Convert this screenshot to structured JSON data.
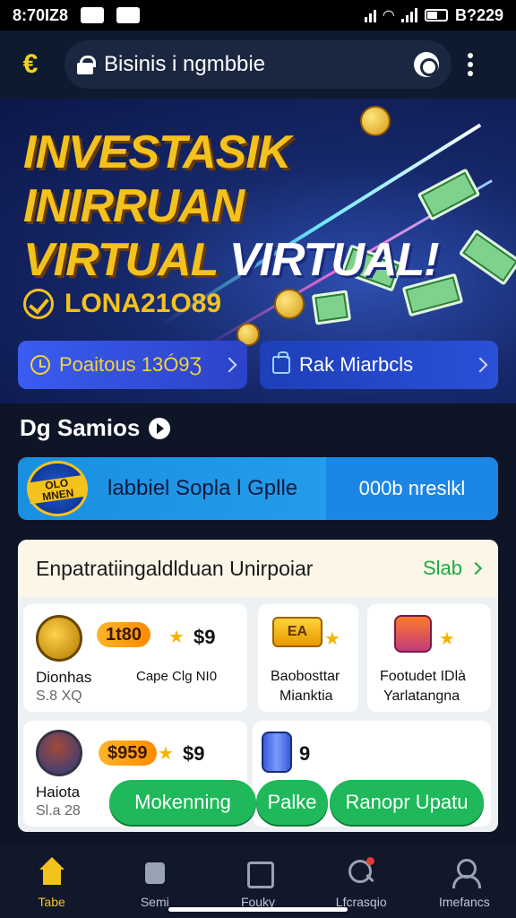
{
  "status_bar": {
    "time": "8:70IZ8",
    "right_time": "B?229"
  },
  "browser": {
    "url": "Bisinis i ngmbbie"
  },
  "hero": {
    "headline_line1": "INVESTASIK INIRRUAN",
    "headline_line2a": "VIRTUAL",
    "headline_line2b": "VIRTUAL!",
    "balance": "LONA21O89",
    "button_left": "Poaitous 13Ó9Ʒ",
    "button_right": "Rak Miarbcls"
  },
  "section": {
    "title": "Dg Samios"
  },
  "promo": {
    "badge_text": "OLO MNEN",
    "text": "labbiel Sopla l Gplle",
    "button": "000b nreslkl"
  },
  "panel": {
    "header": "Enpatratiingaldlduan Unirpoiar",
    "see_all": "Slab",
    "cards": [
      {
        "tag": "1t80",
        "amount": "$9",
        "label": "Dionhas",
        "label2": "Cape Clg NI0",
        "sub": "S.8 XQ"
      },
      {
        "tag": "EA",
        "label": "Baobosttar",
        "sub": "Mianktia"
      },
      {
        "label": "Footudet IDlà",
        "sub": "Yarlatangna"
      },
      {
        "tag": "$959",
        "amount": "$9",
        "label": "Haiota",
        "sub": "Sl.a 28"
      },
      {
        "amount": "9"
      }
    ],
    "actions": [
      "Mokenning",
      "Palke",
      "Ranopr Upatu"
    ]
  },
  "bottom_nav": [
    {
      "label": "Tabe",
      "icon": "home-icon",
      "active": true
    },
    {
      "label": "Semi",
      "icon": "box-icon",
      "active": false
    },
    {
      "label": "Fouky",
      "icon": "document-icon",
      "active": false
    },
    {
      "label": "Lfcrasqio",
      "icon": "search-icon",
      "active": false
    },
    {
      "label": "Imefancs",
      "icon": "user-icon",
      "active": false
    }
  ],
  "colors": {
    "accent": "#f4c21d",
    "green": "#1fb85a",
    "blue": "#1a8fe0"
  }
}
